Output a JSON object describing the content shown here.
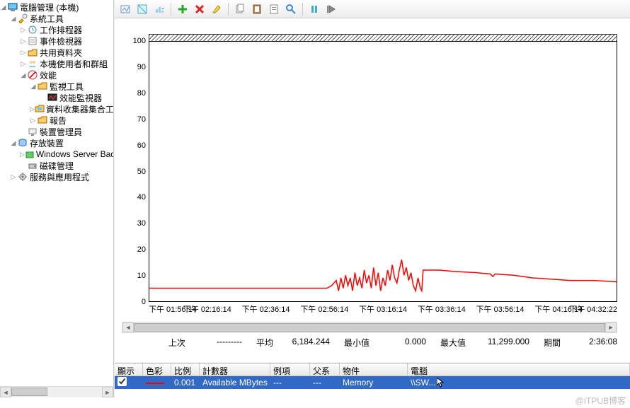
{
  "tree": {
    "root": "電腦管理 (本機)",
    "system_tools": "系統工具",
    "task_scheduler": "工作排程器",
    "event_viewer": "事件檢視器",
    "shared_folders": "共用資料夾",
    "local_users_groups": "本機使用者和群組",
    "performance": "效能",
    "monitoring_tools": "監視工具",
    "perf_monitor": "效能監視器",
    "data_collector_sets": "資料收集器集合工具",
    "reports": "報告",
    "device_manager": "裝置管理員",
    "storage": "存放裝置",
    "wsb": "Windows Server Backu...",
    "disk_mgmt": "磁碟管理",
    "services_apps": "服務與應用程式"
  },
  "chart_data": {
    "type": "line",
    "title": "",
    "ylabel": "",
    "xlabel": "",
    "ylim": [
      0,
      100
    ],
    "yticks": [
      0,
      10,
      20,
      30,
      40,
      50,
      60,
      70,
      80,
      90,
      100
    ],
    "xticks": [
      "下午 01:56:14",
      "下午 02:16:14",
      "下午 02:36:14",
      "下午 02:56:14",
      "下午 03:16:14",
      "下午 03:36:14",
      "下午 03:56:14",
      "下午 04:16:14",
      "下午 04:32:22"
    ],
    "series": [
      {
        "name": "Available MBytes (scaled 0.001)",
        "color": "#ff0000",
        "points": [
          [
            0,
            5
          ],
          [
            5,
            5
          ],
          [
            10,
            5
          ],
          [
            15,
            5
          ],
          [
            20,
            5
          ],
          [
            25,
            5
          ],
          [
            30,
            5
          ],
          [
            35,
            5
          ],
          [
            38,
            5
          ],
          [
            39,
            6
          ],
          [
            40,
            8
          ],
          [
            40.5,
            4
          ],
          [
            41,
            9
          ],
          [
            41.5,
            5
          ],
          [
            42,
            10
          ],
          [
            42.5,
            6
          ],
          [
            43,
            9
          ],
          [
            43.5,
            4
          ],
          [
            44,
            11
          ],
          [
            44.5,
            6
          ],
          [
            45,
            9
          ],
          [
            45.5,
            5
          ],
          [
            46,
            12
          ],
          [
            46.5,
            7
          ],
          [
            47,
            10
          ],
          [
            47.5,
            5
          ],
          [
            48,
            13
          ],
          [
            48.5,
            6
          ],
          [
            49,
            11
          ],
          [
            49.5,
            4
          ],
          [
            50,
            9
          ],
          [
            50.5,
            6
          ],
          [
            51,
            12
          ],
          [
            51.5,
            8
          ],
          [
            52,
            14
          ],
          [
            52.5,
            9
          ],
          [
            53,
            7
          ],
          [
            53.5,
            12
          ],
          [
            54,
            16
          ],
          [
            54.5,
            10
          ],
          [
            55,
            13
          ],
          [
            55.5,
            8
          ],
          [
            56,
            11
          ],
          [
            56.5,
            6
          ],
          [
            57,
            4
          ],
          [
            57.5,
            9
          ],
          [
            58,
            5
          ],
          [
            58.3,
            4
          ],
          [
            58.6,
            12
          ],
          [
            59,
            12
          ],
          [
            62,
            12
          ],
          [
            65,
            11.5
          ],
          [
            70,
            11
          ],
          [
            73,
            10.5
          ],
          [
            73.5,
            9.5
          ],
          [
            74,
            10.5
          ],
          [
            78,
            10
          ],
          [
            82,
            9
          ],
          [
            86,
            8.5
          ],
          [
            90,
            8
          ],
          [
            95,
            8
          ],
          [
            100,
            7.5
          ]
        ]
      }
    ]
  },
  "stats": {
    "last_label": "上次",
    "last_value": "---------",
    "avg_label": "平均",
    "avg_value": "6,184.244",
    "min_label": "最小值",
    "min_value": "0.000",
    "max_label": "最大值",
    "max_value": "11,299.000",
    "dur_label": "期間",
    "dur_value": "2:36:08"
  },
  "grid": {
    "headers": {
      "show": "顯示",
      "color": "色彩",
      "scale": "比例",
      "counter": "計數器",
      "instance": "例項",
      "parent": "父系",
      "object": "物件",
      "computer": "電腦"
    },
    "row": {
      "scale": "0.001",
      "counter": "Available MBytes",
      "instance": "---",
      "parent": "---",
      "object": "Memory",
      "computer": "\\\\SW..."
    }
  },
  "watermark": "@ITPUB博客"
}
